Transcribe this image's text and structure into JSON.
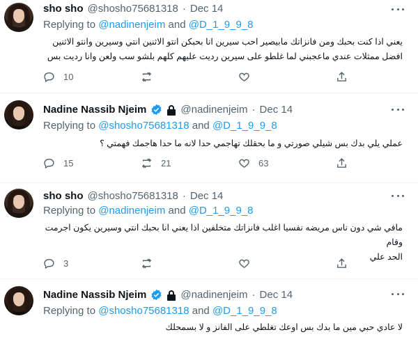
{
  "tweets": [
    {
      "name": "sho sho",
      "handle": "@shosho75681318",
      "dot": "·",
      "date": "Dec 14",
      "replying_prefix": "Replying to",
      "mention1": "@nadinenjeim",
      "and": "and",
      "mention2": "@D_1_9_9_8",
      "body_line1": "يعني اذا كنت بحبك ومن فانزاتك مابيصير احب سيرين انا بحبكن انتو الاثنين انتي وسيرين وانتو الاثنين",
      "body_line2": "افضل ممثلات عندي ماعجبني لما غلطو على سيرين رديت عليهم كلهم بلشو سب ولعن وانا رديت بس",
      "replies": "10",
      "retweets": "",
      "likes": ""
    },
    {
      "name": "Nadine Nassib Njeim",
      "handle": "@nadinenjeim",
      "dot": "·",
      "date": "Dec 14",
      "replying_prefix": "Replying to",
      "mention1": "@shosho75681318",
      "and": "and",
      "mention2": "@D_1_9_9_8",
      "body_line1": "عملي يلي بدك بس شيلي صورتي و ما بحقلك تهاجمي حدا لانه ما حدا هاجمك فهمتي ؟",
      "body_line2": "",
      "replies": "15",
      "retweets": "21",
      "likes": "63"
    },
    {
      "name": "sho sho",
      "handle": "@shosho75681318",
      "dot": "·",
      "date": "Dec 14",
      "replying_prefix": "Replying to",
      "mention1": "@nadinenjeim",
      "and": "and",
      "mention2": "@D_1_9_9_8",
      "body_line1": "مافي شي دون ناس مريضه  نفسيا اغلب فانزاتك متخلفين اذا يعني انا بحبك انتي وسيرين يكون اجرمت وقام",
      "body_line2": "الحد علي",
      "replies": "3",
      "retweets": "",
      "likes": ""
    },
    {
      "name": "Nadine Nassib Njeim",
      "handle": "@nadinenjeim",
      "dot": "·",
      "date": "Dec 14",
      "replying_prefix": "Replying to",
      "mention1": "@shosho75681318",
      "and": "and",
      "mention2": "@D_1_9_9_8",
      "body_line1": "لا عادي حبي مين ما بدك بس اوعك تغلطي على الفانز و لا بسمحلك",
      "body_line2": "",
      "replies": "",
      "retweets": "",
      "likes": ""
    }
  ],
  "colors": {
    "link": "#1d9bf0",
    "muted": "#536471",
    "text": "#0f1419",
    "verified": "#1d9bf0"
  }
}
